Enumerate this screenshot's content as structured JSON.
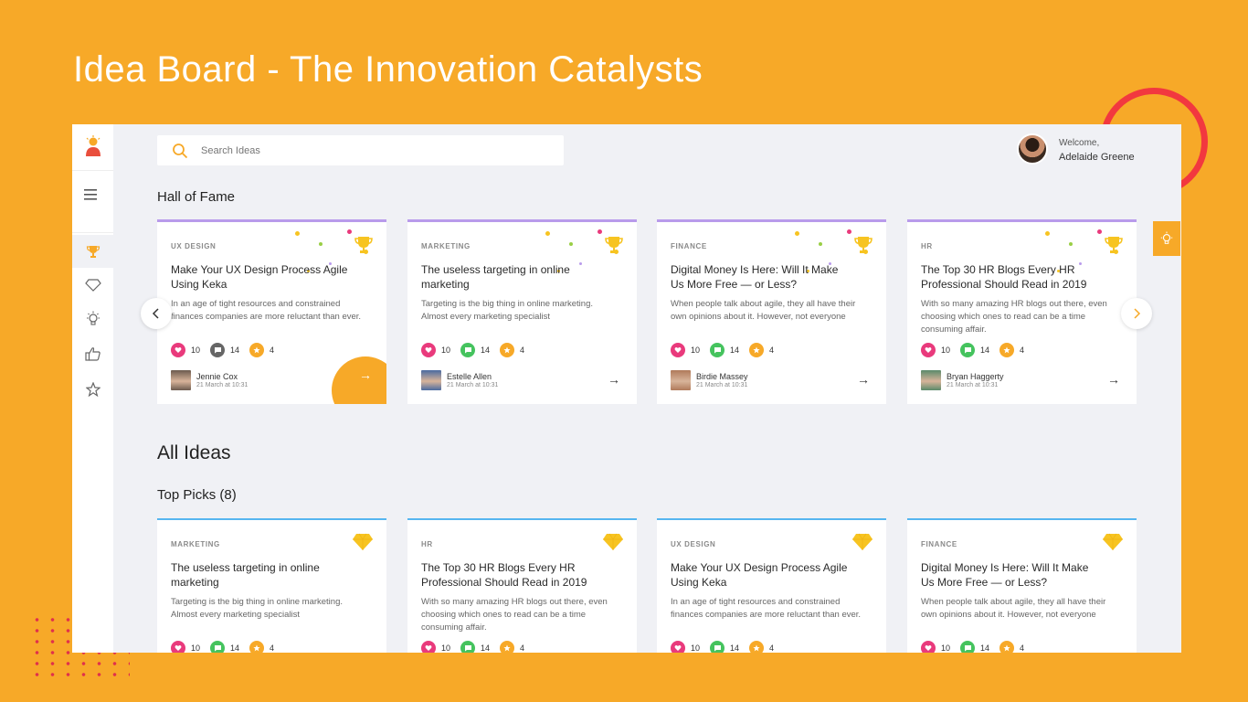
{
  "slide_title": "Idea Board - The Innovation Catalysts",
  "search": {
    "placeholder": "Search Ideas"
  },
  "user": {
    "welcome": "Welcome,",
    "name": "Adelaide Greene"
  },
  "sections": {
    "hall_of_fame": "Hall of Fame",
    "all_ideas": "All Ideas",
    "top_picks": "Top Picks (8)"
  },
  "sidebar": {
    "items": [
      "trophy-icon",
      "gem-icon",
      "bulb-icon",
      "thumbs-up-icon",
      "star-icon"
    ],
    "active": "trophy-icon"
  },
  "colors": {
    "accent": "#F7A928",
    "heart": "#E93A7C",
    "comment": "#45C35E",
    "hof_border": "#B99BEB",
    "pick_border": "#56B6F0"
  },
  "hall_of_fame": [
    {
      "category": "UX DESIGN",
      "title": "Make Your UX Design Process Agile Using Keka",
      "desc": "In an age of tight resources and constrained finances companies are more reluctant than ever.",
      "likes": "10",
      "comments": "14",
      "stars": "4",
      "author": "Jennie Cox",
      "date": "21 March at 10:31"
    },
    {
      "category": "MARKETING",
      "title": "The useless targeting in online marketing",
      "desc": "Targeting is the big thing in online marketing. Almost every marketing specialist",
      "likes": "10",
      "comments": "14",
      "stars": "4",
      "author": "Estelle Allen",
      "date": "21 March at 10:31"
    },
    {
      "category": "FINANCE",
      "title": "Digital Money Is Here: Will It Make Us More Free — or Less?",
      "desc": "When people talk about agile, they all have their own opinions about it. However, not everyone",
      "likes": "10",
      "comments": "14",
      "stars": "4",
      "author": "Birdie Massey",
      "date": "21 March at 10:31"
    },
    {
      "category": "HR",
      "title": "The Top 30 HR Blogs Every HR Professional Should Read in 2019",
      "desc": "With so many amazing HR blogs out there, even choosing which ones to read can be a time consuming affair.",
      "likes": "10",
      "comments": "14",
      "stars": "4",
      "author": "Bryan Haggerty",
      "date": "21 March at 10:31"
    }
  ],
  "top_picks": [
    {
      "category": "MARKETING",
      "title": "The useless targeting in online marketing",
      "desc": "Targeting is the big thing in online marketing. Almost every marketing specialist",
      "likes": "10",
      "comments": "14",
      "stars": "4"
    },
    {
      "category": "HR",
      "title": "The Top 30 HR Blogs Every HR Professional Should Read in 2019",
      "desc": "With so many amazing HR blogs out there, even choosing which ones to read can be a time consuming affair.",
      "likes": "10",
      "comments": "14",
      "stars": "4"
    },
    {
      "category": "UX DESIGN",
      "title": "Make Your UX Design Process Agile Using Keka",
      "desc": "In an age of tight resources and constrained finances companies are more reluctant than ever.",
      "likes": "10",
      "comments": "14",
      "stars": "4"
    },
    {
      "category": "FINANCE",
      "title": "Digital Money Is Here: Will It Make Us More Free — or Less?",
      "desc": "When people talk about agile, they all have their own opinions about it. However, not everyone",
      "likes": "10",
      "comments": "14",
      "stars": "4"
    }
  ]
}
